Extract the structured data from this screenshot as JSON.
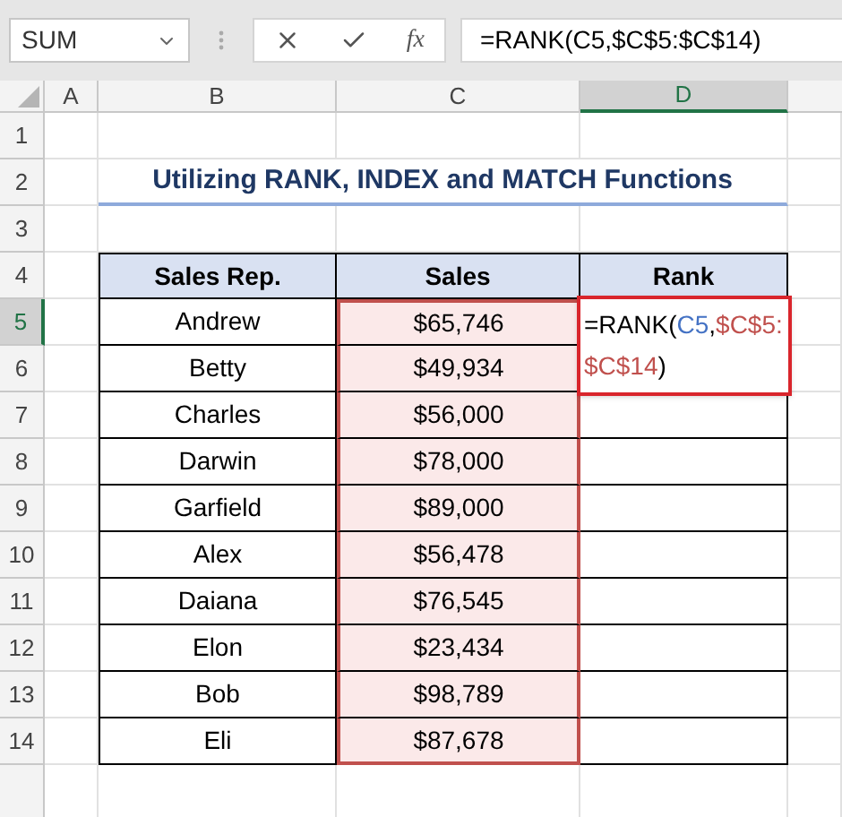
{
  "name_box": "SUM",
  "formula_bar": {
    "fx_label": "fx",
    "formula": "=RANK(C5,$C$5:$C$14)"
  },
  "columns": [
    {
      "label": "A",
      "selected": false
    },
    {
      "label": "B",
      "selected": false
    },
    {
      "label": "C",
      "selected": false
    },
    {
      "label": "D",
      "selected": true
    }
  ],
  "row_numbers": [
    {
      "label": "1",
      "selected": false
    },
    {
      "label": "2",
      "selected": false
    },
    {
      "label": "3",
      "selected": false
    },
    {
      "label": "4",
      "selected": false
    },
    {
      "label": "5",
      "selected": true
    },
    {
      "label": "6",
      "selected": false
    },
    {
      "label": "7",
      "selected": false
    },
    {
      "label": "8",
      "selected": false
    },
    {
      "label": "9",
      "selected": false
    },
    {
      "label": "10",
      "selected": false
    },
    {
      "label": "11",
      "selected": false
    },
    {
      "label": "12",
      "selected": false
    },
    {
      "label": "13",
      "selected": false
    },
    {
      "label": "14",
      "selected": false
    }
  ],
  "title": "Utilizing RANK, INDEX and MATCH Functions",
  "table": {
    "columns": [
      "Sales Rep.",
      "Sales",
      "Rank"
    ],
    "rows": [
      {
        "rep": "Andrew",
        "sales": "$65,746",
        "selected": true
      },
      {
        "rep": "Betty",
        "sales": "$49,934",
        "selected": true
      },
      {
        "rep": "Charles",
        "sales": "$56,000",
        "selected": true
      },
      {
        "rep": "Darwin",
        "sales": "$78,000",
        "selected": true
      },
      {
        "rep": "Garfield",
        "sales": "$89,000",
        "selected": true
      },
      {
        "rep": "Alex",
        "sales": "$56,478",
        "selected": true
      },
      {
        "rep": "Daiana",
        "sales": "$76,545",
        "selected": true
      },
      {
        "rep": "Elon",
        "sales": "$23,434",
        "selected": true
      },
      {
        "rep": "Bob",
        "sales": "$98,789",
        "selected": true
      },
      {
        "rep": "Eli",
        "sales": "$87,678",
        "selected": true
      }
    ],
    "editing_formula": [
      {
        "text": "=RANK(",
        "color": "#000000"
      },
      {
        "text": "C5",
        "color": "#4472c4"
      },
      {
        "text": ",",
        "color": "#000000"
      },
      {
        "text": "$C$5:",
        "color": "#c0504d"
      },
      {
        "text": "$C$14",
        "color": "#c0504d"
      },
      {
        "text": ")",
        "color": "#000000"
      }
    ]
  }
}
